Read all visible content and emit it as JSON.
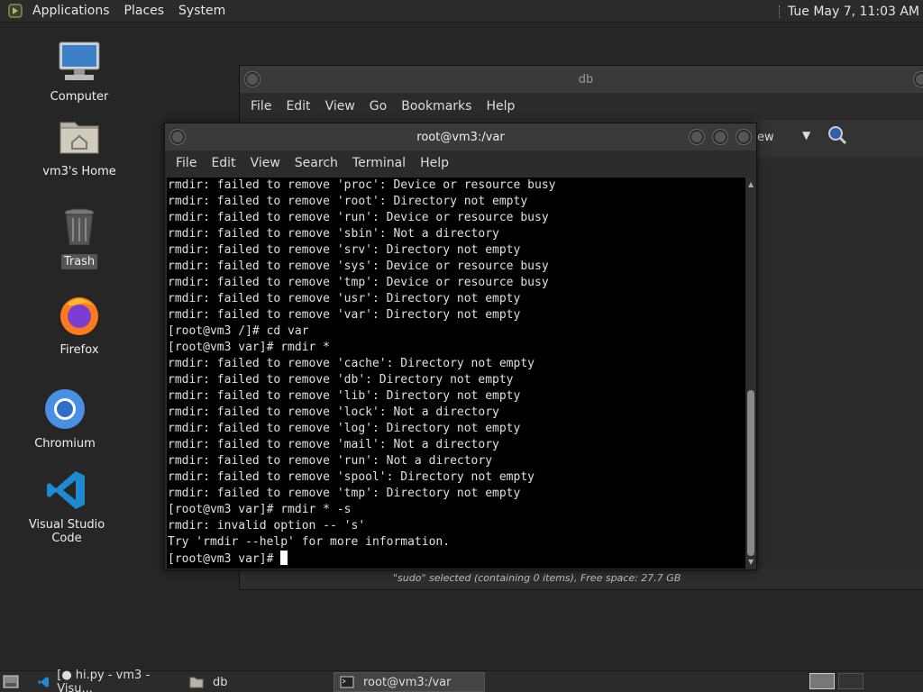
{
  "top_panel": {
    "logo_icon": "distro-logo-icon",
    "menus": [
      "Applications",
      "Places",
      "System"
    ],
    "clock": "Tue May 7, 11:03 AM"
  },
  "desktop_icons": [
    {
      "label": "Computer",
      "icon": "computer-icon"
    },
    {
      "label": "vm3's Home",
      "icon": "home-folder-icon"
    },
    {
      "label": "Trash",
      "icon": "trash-icon"
    },
    {
      "label": "Firefox",
      "icon": "firefox-icon"
    },
    {
      "label": "Chromium",
      "icon": "chromium-icon"
    },
    {
      "label": "Visual Studio Code",
      "icon": "vscode-icon"
    }
  ],
  "file_manager": {
    "title": "db",
    "menus": [
      "File",
      "Edit",
      "View",
      "Go",
      "Bookmarks",
      "Help"
    ],
    "toolbar_partial_label": "ew",
    "status": "\"sudo\" selected (containing 0 items), Free space: 27.7 GB"
  },
  "terminal": {
    "title": "root@vm3:/var",
    "menus": [
      "File",
      "Edit",
      "View",
      "Search",
      "Terminal",
      "Help"
    ],
    "lines": [
      "rmdir: failed to remove 'proc': Device or resource busy",
      "rmdir: failed to remove 'root': Directory not empty",
      "rmdir: failed to remove 'run': Device or resource busy",
      "rmdir: failed to remove 'sbin': Not a directory",
      "rmdir: failed to remove 'srv': Directory not empty",
      "rmdir: failed to remove 'sys': Device or resource busy",
      "rmdir: failed to remove 'tmp': Device or resource busy",
      "rmdir: failed to remove 'usr': Directory not empty",
      "rmdir: failed to remove 'var': Directory not empty",
      "[root@vm3 /]# cd var",
      "[root@vm3 var]# rmdir *",
      "rmdir: failed to remove 'cache': Directory not empty",
      "rmdir: failed to remove 'db': Directory not empty",
      "rmdir: failed to remove 'lib': Directory not empty",
      "rmdir: failed to remove 'lock': Not a directory",
      "rmdir: failed to remove 'log': Directory not empty",
      "rmdir: failed to remove 'mail': Not a directory",
      "rmdir: failed to remove 'run': Not a directory",
      "rmdir: failed to remove 'spool': Directory not empty",
      "rmdir: failed to remove 'tmp': Directory not empty",
      "[root@vm3 var]# rmdir * -s",
      "rmdir: invalid option -- 's'",
      "Try 'rmdir --help' for more information."
    ],
    "prompt": "[root@vm3 var]# "
  },
  "taskbar": {
    "show_desktop_icon": "show-desktop-icon",
    "tasks": [
      {
        "label": "[● hi.py - vm3 - Visu...",
        "icon": "vscode-icon",
        "active": false
      },
      {
        "label": "db",
        "icon": "folder-icon",
        "active": false
      },
      {
        "label": "root@vm3:/var",
        "icon": "terminal-icon",
        "active": true
      }
    ],
    "workspace_icon": "workspace-switcher-icon"
  }
}
